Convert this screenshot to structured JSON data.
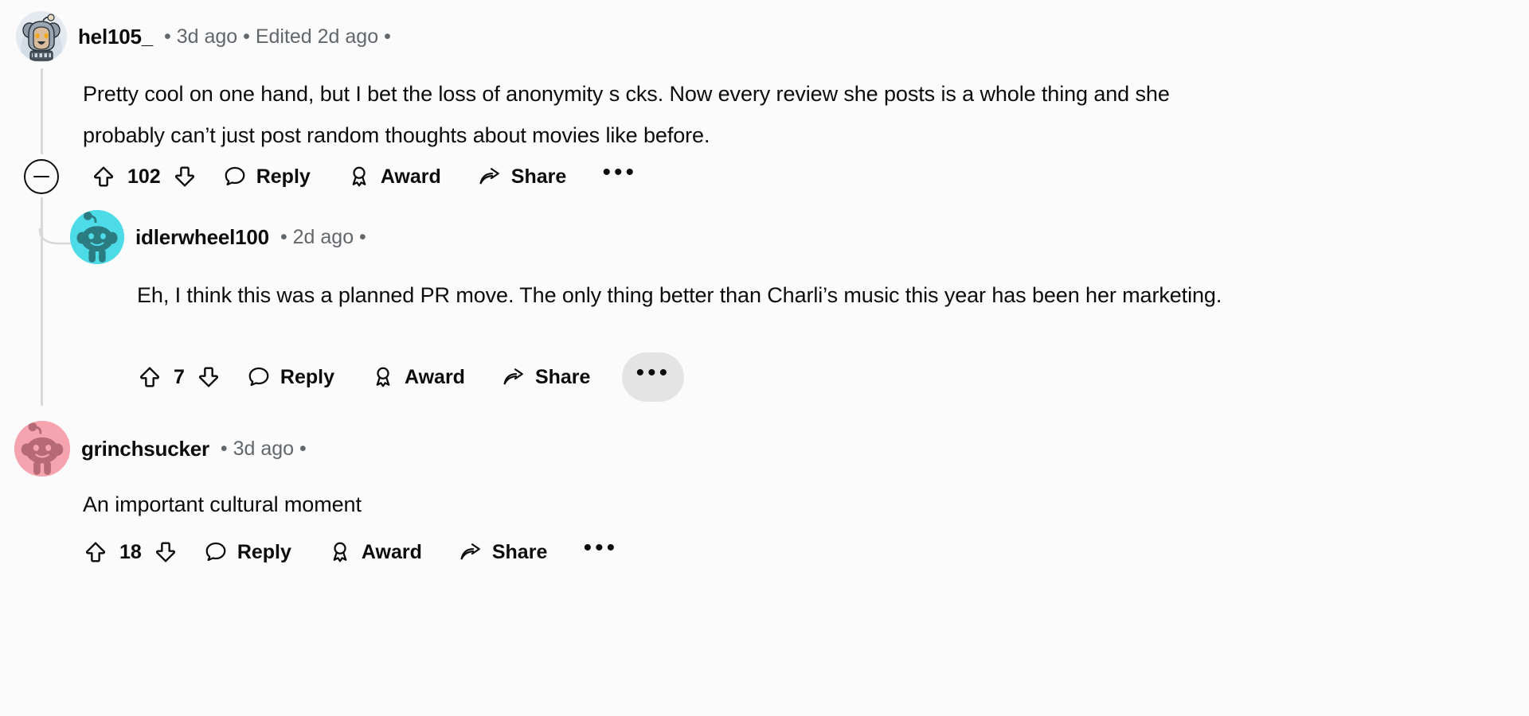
{
  "theme": {
    "background": "#fbfbfb",
    "text_primary": "#0b0c0d",
    "text_muted": "#62676c",
    "thread_line": "#d6d8da",
    "hover_bg": "#e4e4e4"
  },
  "comments": [
    {
      "id": "comment-1",
      "username": "hel105_",
      "meta": "• 3d ago • Edited 2d ago •",
      "timestamp": "3d ago",
      "edited": "Edited 2d ago",
      "body": "Pretty cool on one hand, but I bet the loss of anonymity s  cks. Now every review she posts is a whole thing and she probably can’t just post random thoughts about movies like before.",
      "avatar": {
        "name": "koala-hoodie-avatar",
        "bg": "#dfe4ea",
        "fur": "#8e9aa6",
        "skin": "#d6bc9e",
        "eye": "#f0a71e"
      },
      "collapse_icon": "collapse-minus-icon",
      "upvote_icon": "upvote-arrow-icon",
      "downvote_icon": "downvote-arrow-icon",
      "vote_count": "102",
      "reply_label": "Reply",
      "reply_icon": "comment-bubble-icon",
      "award_label": "Award",
      "award_icon": "award-medal-icon",
      "share_label": "Share",
      "share_icon": "share-arrow-icon",
      "more_label": "•••",
      "more_hovered": false
    },
    {
      "id": "comment-2",
      "username": "idlerwheel100",
      "meta": "• 2d ago •",
      "timestamp": "2d ago",
      "body": "Eh, I think this was a planned PR move. The only thing better than Charli’s music this year has been her marketing.",
      "avatar": {
        "name": "snoo-cyan-avatar",
        "bg": "#4edbe8",
        "fur": "#2b7c80"
      },
      "upvote_icon": "upvote-arrow-icon",
      "downvote_icon": "downvote-arrow-icon",
      "vote_count": "7",
      "reply_label": "Reply",
      "reply_icon": "comment-bubble-icon",
      "award_label": "Award",
      "award_icon": "award-medal-icon",
      "share_label": "Share",
      "share_icon": "share-arrow-icon",
      "more_label": "•••",
      "more_hovered": true
    },
    {
      "id": "comment-3",
      "username": "grinchsucker",
      "meta": "• 3d ago •",
      "timestamp": "3d ago",
      "body": "An important cultural moment",
      "avatar": {
        "name": "snoo-pink-avatar",
        "bg": "#f6a3b0",
        "fur": "#b56a74"
      },
      "upvote_icon": "upvote-arrow-icon",
      "downvote_icon": "downvote-arrow-icon",
      "vote_count": "18",
      "reply_label": "Reply",
      "reply_icon": "comment-bubble-icon",
      "award_label": "Award",
      "award_icon": "award-medal-icon",
      "share_label": "Share",
      "share_icon": "share-arrow-icon",
      "more_label": "•••",
      "more_hovered": false
    }
  ]
}
